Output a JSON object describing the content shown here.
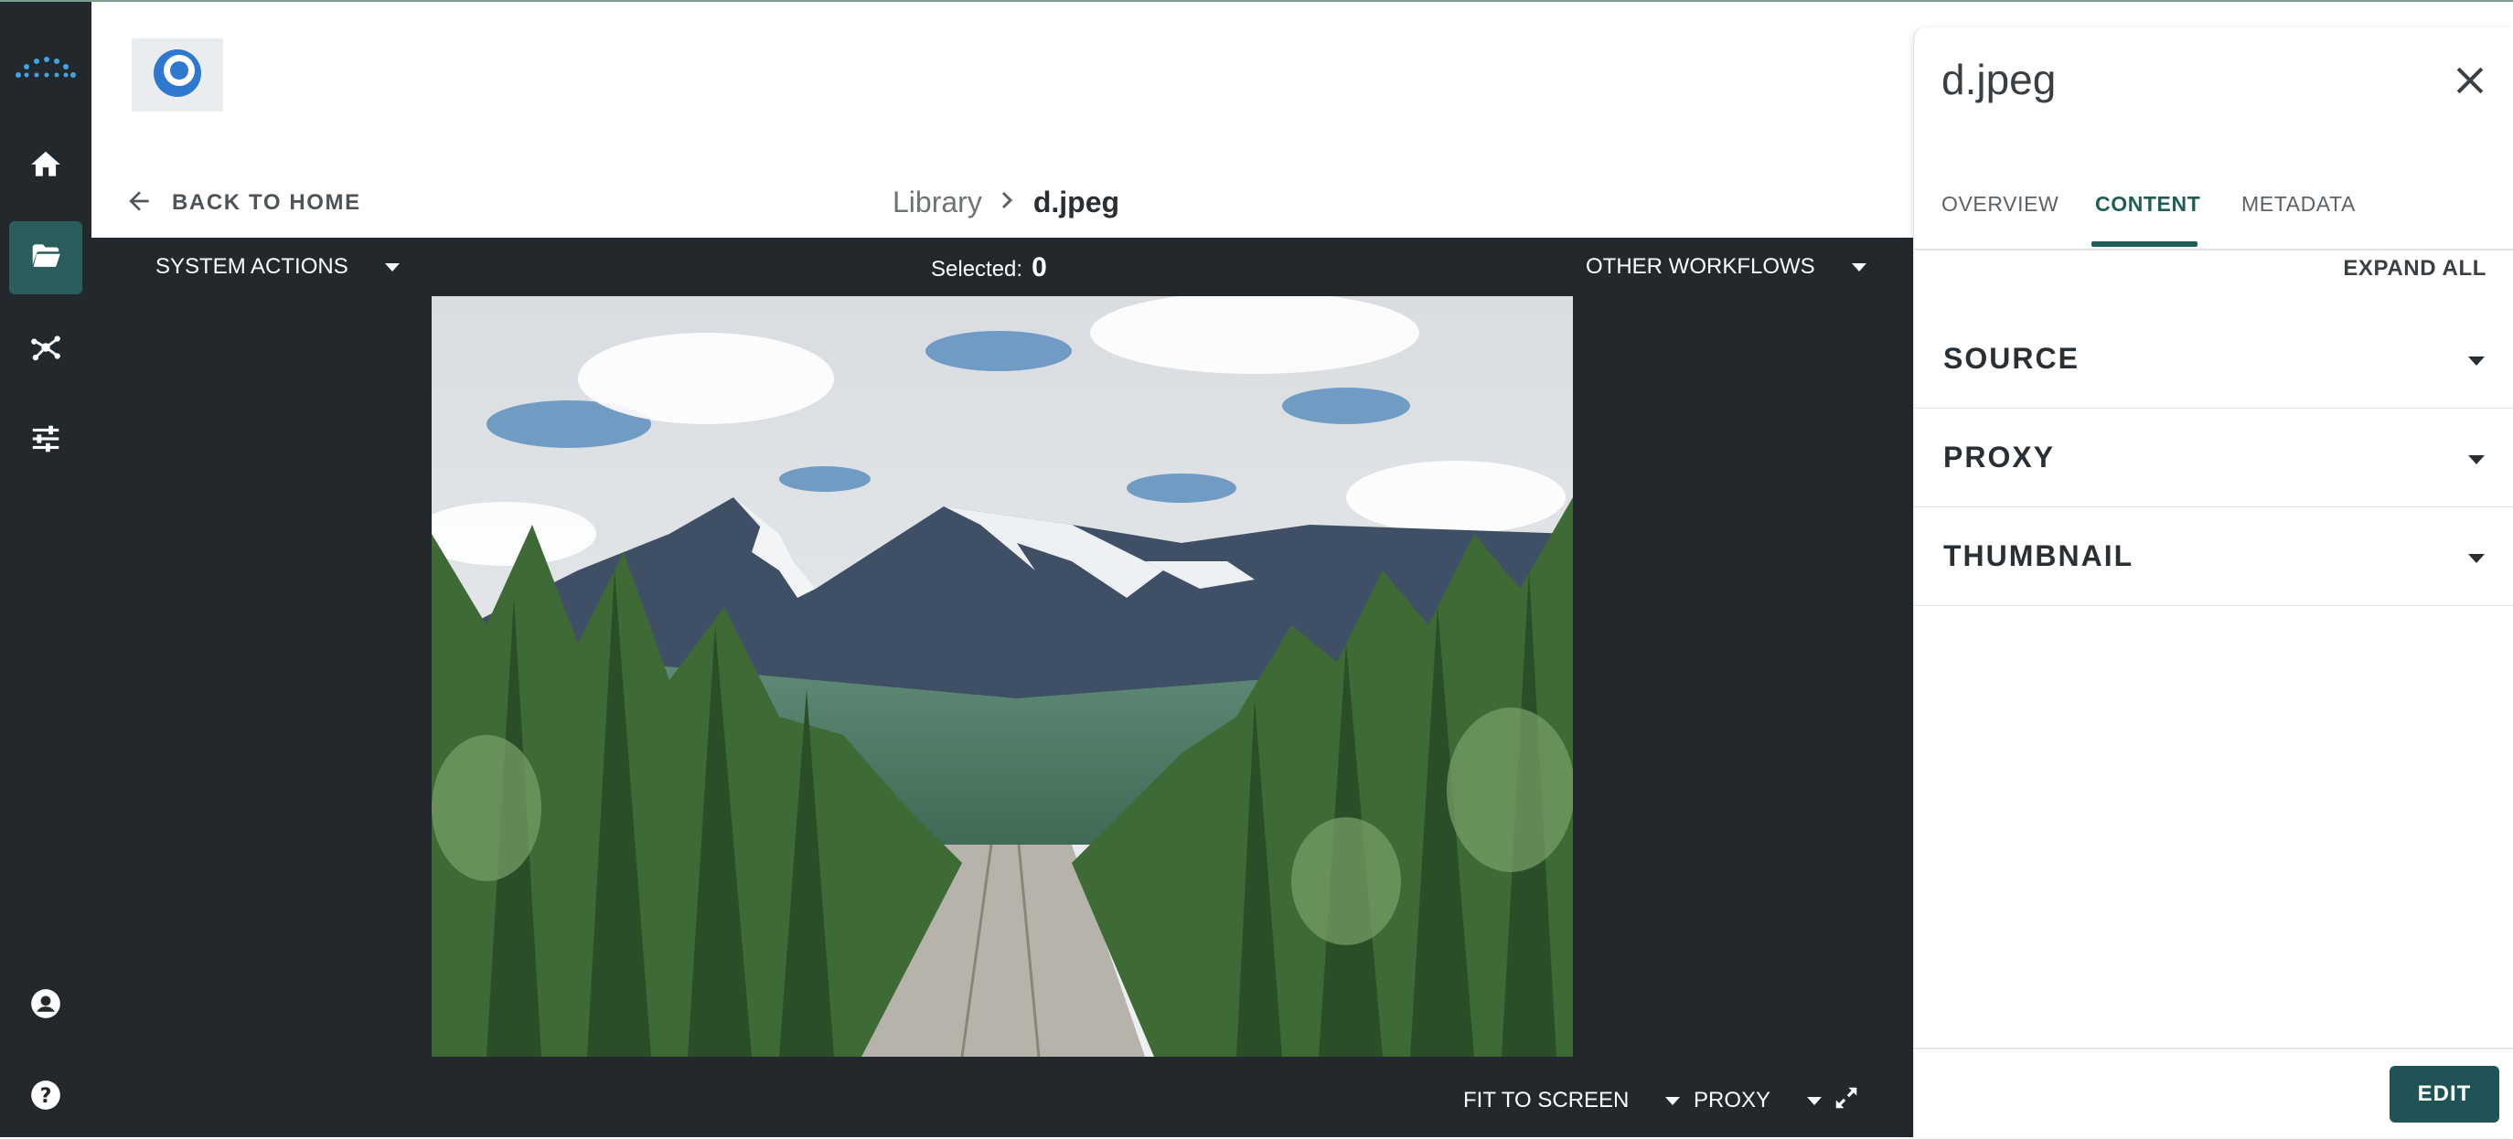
{
  "nav": {
    "items": [
      {
        "name": "home",
        "icon": "home-icon"
      },
      {
        "name": "library",
        "icon": "folder-open-icon",
        "active": true
      },
      {
        "name": "workflows",
        "icon": "network-icon"
      },
      {
        "name": "settings",
        "icon": "sliders-icon"
      },
      {
        "name": "account",
        "icon": "account-circle-icon"
      },
      {
        "name": "help",
        "icon": "help-circle-icon"
      }
    ]
  },
  "header": {
    "back_label": "BACK TO HOME",
    "breadcrumb": {
      "parent": "Library",
      "current": "d.jpeg"
    }
  },
  "viewer": {
    "system_actions_label": "SYSTEM ACTIONS",
    "selected_label": "Selected:",
    "selected_count": "0",
    "other_workflows_label": "OTHER WORKFLOWS",
    "fit_label": "FIT TO SCREEN",
    "rendition_label": "PROXY"
  },
  "panel": {
    "title": "d.jpeg",
    "tabs": [
      {
        "label": "OVERVIEW",
        "active": false
      },
      {
        "label": "CONTENT",
        "active": true
      },
      {
        "label": "METADATA",
        "active": false
      }
    ],
    "expand_all_label": "EXPAND ALL",
    "sections": [
      {
        "label": "SOURCE"
      },
      {
        "label": "PROXY"
      },
      {
        "label": "THUMBNAIL"
      }
    ],
    "edit_label": "EDIT"
  },
  "colors": {
    "accent": "#1f5d5a",
    "rail": "#22282c",
    "rail_active": "#2a5d5c",
    "logo_blue": "#2f78d0"
  }
}
